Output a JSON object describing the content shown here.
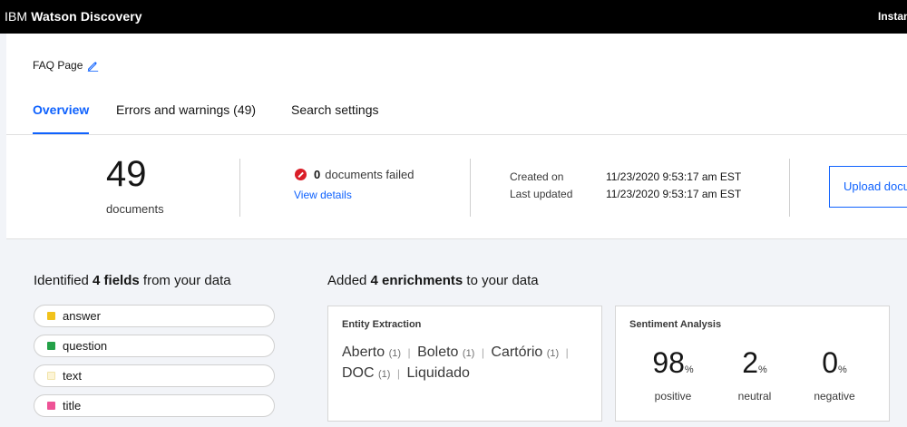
{
  "topbar": {
    "brand_prefix": "IBM",
    "brand_name": "Watson Discovery",
    "instance_label": "Instan"
  },
  "header": {
    "page_name": "FAQ Page",
    "tabs": [
      {
        "label": "Overview",
        "active": true
      },
      {
        "label": "Errors and warnings (49)",
        "active": false
      },
      {
        "label": "Search settings",
        "active": false
      }
    ]
  },
  "stats": {
    "documents_count": "49",
    "documents_label": "documents",
    "failed_count": "0",
    "failed_label": "documents failed",
    "view_details": "View details",
    "created_label": "Created on",
    "created_value": "11/23/2020 9:53:17 am EST",
    "updated_label": "Last updated",
    "updated_value": "11/23/2020 9:53:17 am EST",
    "upload_label": "Upload docu"
  },
  "fields_section": {
    "prefix": "Identified ",
    "count_text": "4 fields",
    "suffix": " from your data",
    "items": [
      {
        "label": "answer",
        "color": "#f1c21b"
      },
      {
        "label": "question",
        "color": "#24a148"
      },
      {
        "label": "text",
        "color": "#fcf4d6"
      },
      {
        "label": "title",
        "color": "#ee5396"
      }
    ]
  },
  "enrichments_section": {
    "prefix": "Added ",
    "count_text": "4 enrichments",
    "suffix": " to your data"
  },
  "entity_card": {
    "title": "Entity Extraction",
    "line1": [
      {
        "name": "Aberto",
        "count": "(1)"
      },
      {
        "name": "Boleto",
        "count": "(1)"
      },
      {
        "name": "Cartório",
        "count": "(1)"
      }
    ],
    "line2": [
      {
        "name": "DOC",
        "count": "(1)"
      },
      {
        "name": "Liquidado",
        "count": ""
      }
    ],
    "separator": "|"
  },
  "sentiment_card": {
    "title": "Sentiment Analysis",
    "items": [
      {
        "value": "98",
        "unit": "%",
        "label": "positive"
      },
      {
        "value": "2",
        "unit": "%",
        "label": "neutral"
      },
      {
        "value": "0",
        "unit": "%",
        "label": "negative"
      }
    ]
  },
  "colors": {
    "accent": "#0f62fe",
    "error": "#da1e28"
  }
}
